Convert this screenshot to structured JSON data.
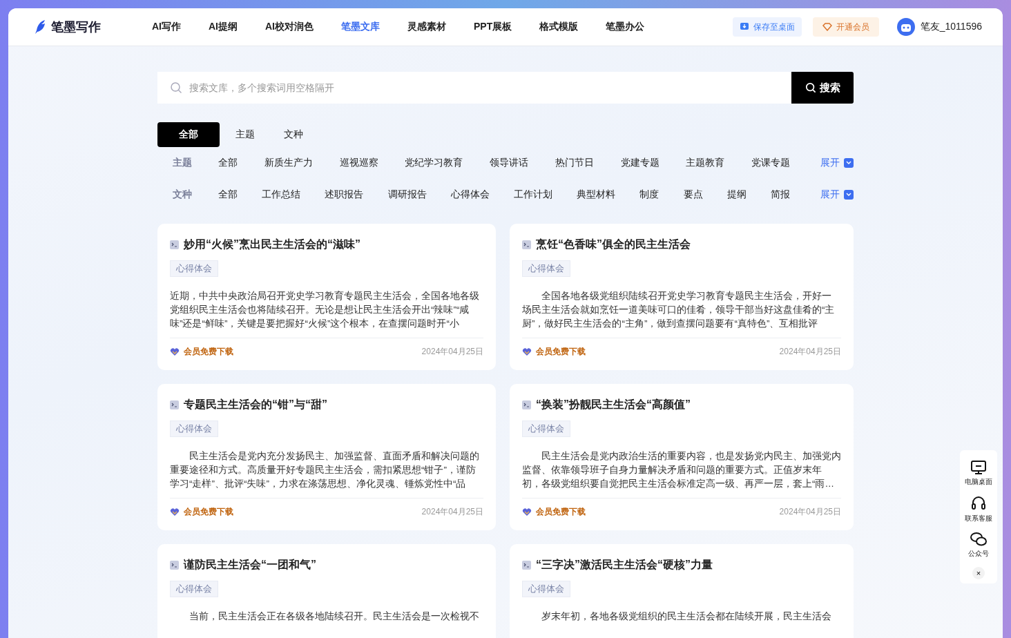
{
  "header": {
    "logo": "笔墨写作",
    "nav": [
      {
        "label": "AI写作",
        "selected": false
      },
      {
        "label": "AI提纲",
        "selected": false
      },
      {
        "label": "AI校对润色",
        "selected": false
      },
      {
        "label": "笔墨文库",
        "selected": true
      },
      {
        "label": "灵感素材",
        "selected": false
      },
      {
        "label": "PPT展板",
        "selected": false
      },
      {
        "label": "格式模版",
        "selected": false
      },
      {
        "label": "笔墨办公",
        "selected": false
      }
    ],
    "save_button": "保存至桌面",
    "vip_button": "开通会员",
    "username": "笔友_1011596"
  },
  "search": {
    "placeholder": "搜索文库，多个搜索词用空格隔开",
    "button": "搜索"
  },
  "tabs": [
    {
      "label": "全部",
      "selected": true
    },
    {
      "label": "主题",
      "selected": false
    },
    {
      "label": "文种",
      "selected": false
    }
  ],
  "filters": [
    {
      "label": "主题",
      "options": [
        "全部",
        "新质生产力",
        "巡视巡察",
        "党纪学习教育",
        "领导讲话",
        "热门节日",
        "党建专题",
        "主题教育",
        "党课专题"
      ],
      "expand": "展开"
    },
    {
      "label": "文种",
      "options": [
        "全部",
        "工作总结",
        "述职报告",
        "调研报告",
        "心得体会",
        "工作计划",
        "典型材料",
        "制度",
        "要点",
        "提纲",
        "简报"
      ],
      "expand": "展开"
    }
  ],
  "cards": [
    {
      "title": "妙用“火候”烹出民主生活会的“滋味”",
      "tag": "心得体会",
      "indent": false,
      "lines": [
        "近期，中共中央政治局召开党史学习教育专题民主生活会，全国各地各级",
        "党组织民主生活会也将陆续召开。无论是想让民主生活会开出“辣味”“咸",
        "味”还是“鲜味”，关键是要把握好“火候”这个根本，在查摆问题时开“小"
      ],
      "download": "会员免费下载",
      "date": "2024年04月25日"
    },
    {
      "title": "烹饪“色香味”俱全的民主生活会",
      "tag": "心得体会",
      "indent": true,
      "lines": [
        "全国各地各级党组织陆续召开党史学习教育专题民主生活会，开好一",
        "场民主生活会就如烹饪一道美味可口的佳肴，领导干部当好这盘佳肴的“主",
        "厨”，做好民主生活会的“主角”，做到查摆问题要有“真特色”、互相批评"
      ],
      "download": "会员免费下载",
      "date": "2024年04月25日"
    },
    {
      "title": "专题民主生活会的“钳”与“甜”",
      "tag": "心得体会",
      "indent": true,
      "lines": [
        "民主生活会是党内充分发扬民主、加强监督、直面矛盾和解决问题的",
        "重要途径和方式。高质量开好专题民主生活会，需扣紧思想“钳子”，谨防",
        "学习“走样”、批评“失味”，力求在涤荡思想、净化灵魂、锤炼党性中“品"
      ],
      "download": "会员免费下载",
      "date": "2024年04月25日"
    },
    {
      "title": "“换装”扮靓民主生活会“高颜值”",
      "tag": "心得体会",
      "indent": true,
      "lines": [
        "民主生活会是党内政治生活的重要内容，也是发扬党内民主、加强党内",
        "监督、依靠领导班子自身力量解决矛盾和问题的重要方式。正值岁末年",
        "初，各级党组织要自觉把民主生活会标准定高一级、再严一层，套上“雨…"
      ],
      "download": "会员免费下载",
      "date": "2024年04月25日"
    },
    {
      "title": "谨防民主生活会“一团和气”",
      "tag": "心得体会",
      "indent": true,
      "lines": [
        "当前，民主生活会正在各级各地陆续召开。民主生活会是一次检视不"
      ]
    },
    {
      "title": "“三字决”激活民主生活会“硬核”力量",
      "tag": "心得体会",
      "indent": true,
      "lines": [
        "岁末年初，各地各级党组织的民主生活会都在陆续开展，民主生活会"
      ]
    }
  ],
  "side_panel": {
    "items": [
      {
        "kind": "desktop",
        "label": "电脑桌面"
      },
      {
        "kind": "service",
        "label": "联系客服"
      },
      {
        "kind": "wechat",
        "label": "公众号"
      }
    ],
    "close": "×"
  }
}
